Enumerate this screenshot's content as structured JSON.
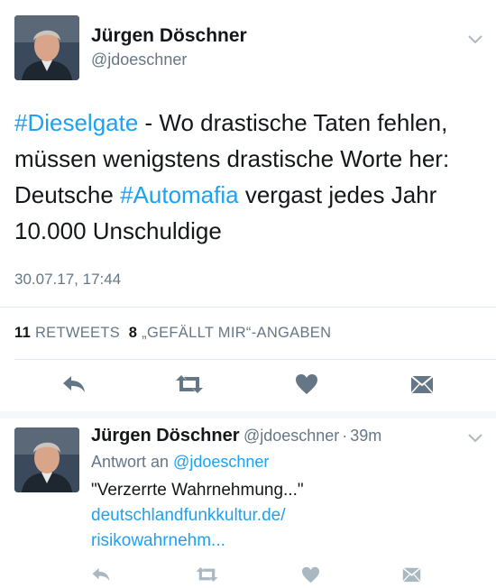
{
  "tweet": {
    "author_name": "Jürgen Döschner",
    "author_handle": "@jdoeschner",
    "text_parts": {
      "hashtag1": "#Dieselgate",
      "line1_rest": " - Wo drastische Taten fehlen,",
      "line2": "müssen wenigstens drastische Worte her:",
      "line3_pre": "Deutsche ",
      "hashtag2": "#Automafia",
      "line3_post": " vergast jedes Jahr",
      "line4": "10.000 Unschuldige"
    },
    "timestamp": "30.07.17, 17:44",
    "retweets_count": "11",
    "retweets_label": "RETWEETS",
    "likes_count": "8",
    "likes_label": "„GEFÄLLT MIR“-ANGABEN"
  },
  "reply": {
    "author_name": "Jürgen Döschner",
    "author_handle": "@jdoeschner",
    "separator": "·",
    "age": "39m",
    "reply_to_prefix": "Antwort an ",
    "reply_to_handle": "@jdoeschner",
    "text": "\"Verzerrte Wahrnehmung...\"",
    "link_line1": "deutschlandfunkkultur.de/",
    "link_line2": "risikowahrnehm..."
  },
  "icons": {
    "reply": "reply-icon",
    "retweet": "retweet-icon",
    "like": "heart-icon",
    "dm": "envelope-icon",
    "more": "chevron-down-icon"
  },
  "colors": {
    "link": "#1da1f2",
    "secondary_text": "#657786",
    "divider": "#e1e8ed"
  }
}
